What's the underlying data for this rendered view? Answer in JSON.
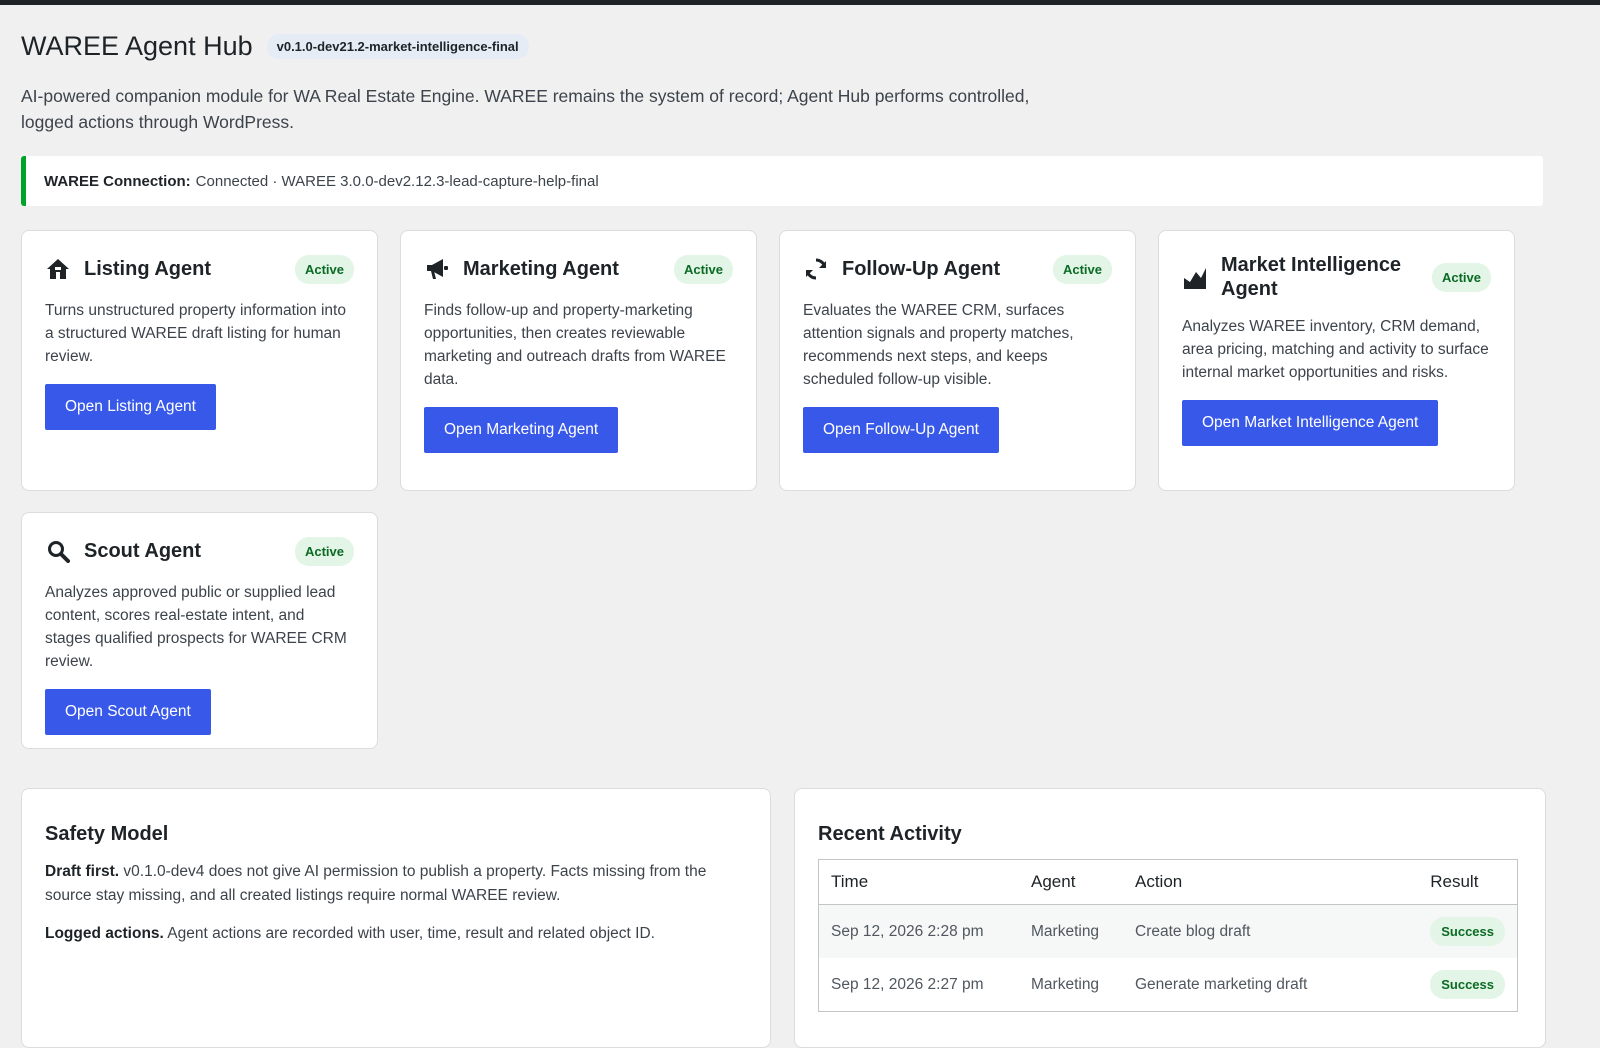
{
  "header": {
    "title": "WAREE Agent Hub",
    "version": "v0.1.0-dev21.2-market-intelligence-final",
    "intro": "AI-powered companion module for WA Real Estate Engine. WAREE remains the system of record; Agent Hub performs controlled, logged actions through WordPress."
  },
  "connection": {
    "label": "WAREE Connection:",
    "status": "Connected · WAREE 3.0.0-dev2.12.3-lead-capture-help-final",
    "accent_color": "#00a32a"
  },
  "colors": {
    "primary_button": "#3858e9",
    "badge_bg": "#e3f5e6",
    "badge_text": "#0b6b25"
  },
  "agents": [
    {
      "title": "Listing Agent",
      "icon": "home-icon",
      "status": "Active",
      "description": "Turns unstructured property information into a structured WAREE draft listing for human review.",
      "button": "Open Listing Agent"
    },
    {
      "title": "Marketing Agent",
      "icon": "megaphone-icon",
      "status": "Active",
      "description": "Finds follow-up and property-marketing opportunities, then creates reviewable marketing and outreach drafts from WAREE data.",
      "button": "Open Marketing Agent"
    },
    {
      "title": "Follow-Up Agent",
      "icon": "refresh-icon",
      "status": "Active",
      "description": "Evaluates the WAREE CRM, surfaces attention signals and property matches, recommends next steps, and keeps scheduled follow-up visible.",
      "button": "Open Follow-Up Agent"
    },
    {
      "title": "Market Intelligence Agent",
      "icon": "chart-area-icon",
      "status": "Active",
      "description": "Analyzes WAREE inventory, CRM demand, area pricing, matching and activity to surface internal market opportunities and risks.",
      "button": "Open Market Intelligence Agent"
    },
    {
      "title": "Scout Agent",
      "icon": "search-icon",
      "status": "Active",
      "description": "Analyzes approved public or supplied lead content, scores real-estate intent, and stages qualified prospects for WAREE CRM review.",
      "button": "Open Scout Agent"
    }
  ],
  "safety": {
    "title": "Safety Model",
    "p1_bold": "Draft first.",
    "p1_text": "v0.1.0-dev4 does not give AI permission to publish a property. Facts missing from the source stay missing, and all created listings require normal WAREE review.",
    "p2_bold": "Logged actions.",
    "p2_text": "Agent actions are recorded with user, time, result and related object ID."
  },
  "activity": {
    "title": "Recent Activity",
    "columns": [
      "Time",
      "Agent",
      "Action",
      "Result"
    ],
    "rows": [
      {
        "time": "Sep 12, 2026 2:28 pm",
        "agent": "Marketing",
        "action": "Create blog draft",
        "result": "Success"
      },
      {
        "time": "Sep 12, 2026 2:27 pm",
        "agent": "Marketing",
        "action": "Generate marketing draft",
        "result": "Success"
      }
    ]
  }
}
